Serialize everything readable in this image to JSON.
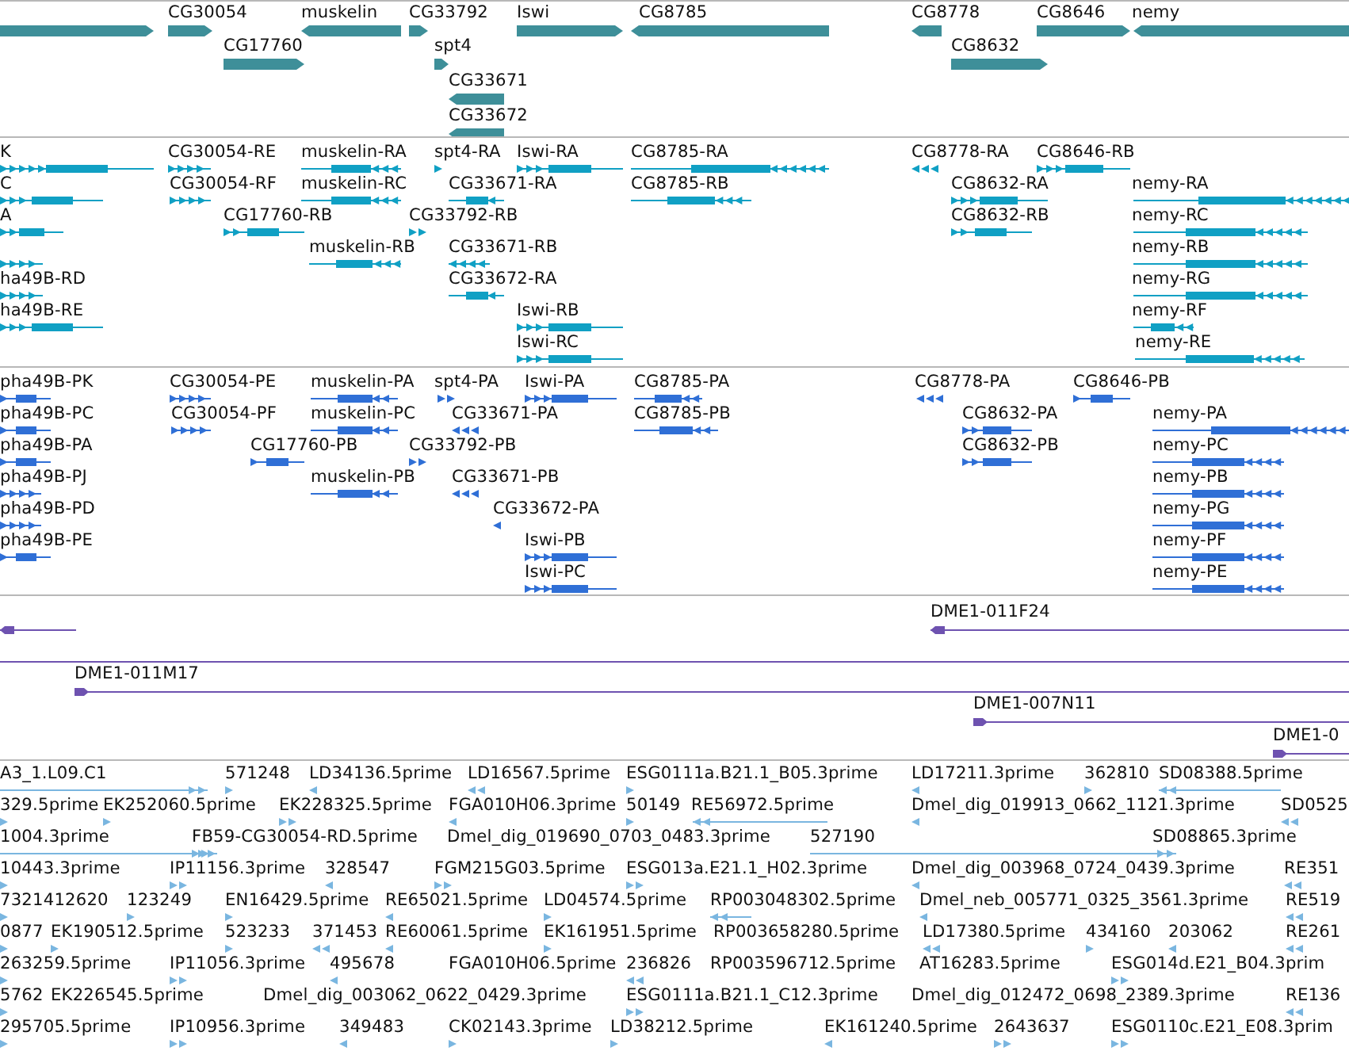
{
  "tracks": [
    {
      "kind": "gene",
      "rows": [
        {
          "features": [
            {
              "kind": "forward"
            },
            {
              "label": "CG30054",
              "kind": "forward"
            },
            {
              "label": "muskelin",
              "kind": "reverse"
            },
            {
              "label": "CG33792",
              "kind": "forward"
            },
            {
              "label": "Iswi",
              "kind": "forward"
            },
            {
              "label": "CG8785",
              "kind": "reverse"
            },
            {
              "label": "CG8778",
              "kind": "reverse"
            },
            {
              "label": "CG8646",
              "kind": "forward"
            },
            {
              "label": "nemy",
              "kind": "reverse"
            }
          ]
        },
        {
          "features": [
            {
              "label": "CG17760",
              "kind": "forward"
            },
            {
              "label": "spt4",
              "kind": "forward"
            },
            {
              "label": "CG8632",
              "kind": "forward"
            }
          ]
        },
        {
          "features": [
            {
              "label": "CG33671",
              "kind": "reverse"
            }
          ]
        },
        {
          "features": [
            {
              "label": "CG33672",
              "kind": "reverse"
            }
          ]
        }
      ]
    },
    {
      "kind": "transcript",
      "rows": [
        {
          "features": [
            {
              "label": "K",
              "kind": "forward"
            },
            {
              "label": "CG30054-RE",
              "kind": "forward"
            },
            {
              "label": "muskelin-RA",
              "kind": "reverse"
            },
            {
              "label": "spt4-RA",
              "kind": "forward"
            },
            {
              "label": "Iswi-RA",
              "kind": "forward"
            },
            {
              "label": "CG8785-RA",
              "kind": "reverse"
            },
            {
              "label": "CG8778-RA",
              "kind": "reverse"
            },
            {
              "label": "CG8646-RB",
              "kind": "forward"
            }
          ]
        },
        {
          "features": [
            {
              "label": "C",
              "kind": "forward"
            },
            {
              "label": "CG30054-RF",
              "kind": "forward"
            },
            {
              "label": "muskelin-RC",
              "kind": "reverse"
            },
            {
              "label": "CG33671-RA",
              "kind": "reverse"
            },
            {
              "label": "CG8785-RB",
              "kind": "reverse"
            },
            {
              "label": "CG8632-RA",
              "kind": "forward"
            },
            {
              "label": "nemy-RA",
              "kind": "reverse"
            }
          ]
        },
        {
          "features": [
            {
              "label": "A",
              "kind": "forward"
            },
            {
              "label": "CG17760-RB",
              "kind": "forward"
            },
            {
              "label": "CG33792-RB",
              "kind": "forward"
            },
            {
              "label": "CG8632-RB",
              "kind": "forward"
            },
            {
              "label": "nemy-RC",
              "kind": "reverse"
            }
          ]
        },
        {
          "features": [
            {
              "kind": "forward"
            },
            {
              "label": "muskelin-RB",
              "kind": "reverse"
            },
            {
              "label": "CG33671-RB",
              "kind": "reverse"
            },
            {
              "label": "nemy-RB",
              "kind": "reverse"
            }
          ]
        },
        {
          "features": [
            {
              "label": "ha49B-RD",
              "kind": "forward"
            },
            {
              "label": "CG33672-RA",
              "kind": "reverse"
            },
            {
              "label": "nemy-RG",
              "kind": "reverse"
            }
          ]
        },
        {
          "features": [
            {
              "label": "ha49B-RE",
              "kind": "forward"
            },
            {
              "label": "Iswi-RB",
              "kind": "forward"
            },
            {
              "label": "nemy-RF",
              "kind": "reverse"
            }
          ]
        },
        {
          "features": [
            {
              "label": "Iswi-RC",
              "kind": "forward"
            },
            {
              "label": "nemy-RE",
              "kind": "reverse"
            }
          ]
        }
      ]
    },
    {
      "kind": "protein",
      "rows": [
        {
          "features": [
            {
              "label": "pha49B-PK",
              "kind": "forward"
            },
            {
              "label": "CG30054-PE",
              "kind": "forward"
            },
            {
              "label": "muskelin-PA",
              "kind": "reverse"
            },
            {
              "label": "spt4-PA",
              "kind": "forward"
            },
            {
              "label": "Iswi-PA",
              "kind": "forward"
            },
            {
              "label": "CG8785-PA",
              "kind": "reverse"
            },
            {
              "label": "CG8778-PA",
              "kind": "reverse"
            },
            {
              "label": "CG8646-PB",
              "kind": "forward"
            }
          ]
        },
        {
          "features": [
            {
              "label": "pha49B-PC",
              "kind": "forward"
            },
            {
              "label": "CG30054-PF",
              "kind": "forward"
            },
            {
              "label": "muskelin-PC",
              "kind": "reverse"
            },
            {
              "label": "CG33671-PA",
              "kind": "reverse"
            },
            {
              "label": "CG8785-PB",
              "kind": "reverse"
            },
            {
              "label": "CG8632-PA",
              "kind": "forward"
            },
            {
              "label": "nemy-PA",
              "kind": "reverse"
            }
          ]
        },
        {
          "features": [
            {
              "label": "pha49B-PA",
              "kind": "forward"
            },
            {
              "label": "CG17760-PB",
              "kind": "forward"
            },
            {
              "label": "CG33792-PB",
              "kind": "forward"
            },
            {
              "label": "CG8632-PB",
              "kind": "forward"
            },
            {
              "label": "nemy-PC",
              "kind": "reverse"
            }
          ]
        },
        {
          "features": [
            {
              "label": "pha49B-PJ",
              "kind": "forward"
            },
            {
              "label": "muskelin-PB",
              "kind": "reverse"
            },
            {
              "label": "CG33671-PB",
              "kind": "reverse"
            },
            {
              "label": "nemy-PB",
              "kind": "reverse"
            }
          ]
        },
        {
          "features": [
            {
              "label": "pha49B-PD",
              "kind": "forward"
            },
            {
              "label": "CG33672-PA",
              "kind": "reverse"
            },
            {
              "label": "nemy-PG",
              "kind": "reverse"
            }
          ]
        },
        {
          "features": [
            {
              "label": "pha49B-PE",
              "kind": "forward"
            },
            {
              "label": "Iswi-PB",
              "kind": "forward"
            },
            {
              "label": "nemy-PF",
              "kind": "reverse"
            }
          ]
        },
        {
          "features": [
            {
              "label": "Iswi-PC",
              "kind": "forward"
            },
            {
              "label": "nemy-PE",
              "kind": "reverse"
            }
          ]
        }
      ]
    },
    {
      "kind": "clone",
      "rows": [
        {
          "features": [
            {
              "kind": "reverse"
            },
            {
              "label": "DME1-011F24",
              "kind": "reverse"
            }
          ]
        },
        {
          "features": [
            {
              "kind": "line"
            }
          ]
        },
        {
          "features": [
            {
              "label": "DME1-011M17",
              "kind": "forward"
            }
          ]
        },
        {
          "features": [
            {
              "label": "DME1-007N11",
              "kind": "forward"
            }
          ]
        },
        {
          "features": [
            {
              "label": "DME1-0",
              "kind": "forward"
            }
          ]
        }
      ]
    },
    {
      "kind": "est",
      "rows": [
        {
          "features": [
            {
              "label": "A3_1.L09.C1",
              "kind": "forward"
            },
            {
              "label": "571248",
              "kind": "forward"
            },
            {
              "label": "LD34136.5prime",
              "kind": "reverse"
            },
            {
              "label": "LD16567.5prime",
              "kind": "reverse"
            },
            {
              "label": "ESG0111a.B21.1_B05.3prime",
              "kind": "forward"
            },
            {
              "label": "LD17211.3prime",
              "kind": "reverse"
            },
            {
              "label": "362810",
              "kind": "forward"
            },
            {
              "label": "SD08388.5prime",
              "kind": "reverse"
            }
          ]
        },
        {
          "features": [
            {
              "label": "329.5prime",
              "kind": "forward"
            },
            {
              "label": "EK252060.5prime",
              "kind": "forward"
            },
            {
              "label": "EK228325.5prime",
              "kind": "forward"
            },
            {
              "label": "FGA010H06.3prime",
              "kind": "reverse"
            },
            {
              "label": "50149",
              "kind": "forward"
            },
            {
              "label": "RE56972.5prime",
              "kind": "reverse"
            },
            {
              "label": "Dmel_dig_019913_0662_1121.3prime",
              "kind": "reverse"
            },
            {
              "label": "SD0525",
              "kind": "reverse"
            }
          ]
        },
        {
          "features": [
            {
              "label": "1004.3prime",
              "kind": "forward"
            },
            {
              "label": "FB59-CG30054-RD.5prime",
              "kind": "forward"
            },
            {
              "label": "Dmel_dig_019690_0703_0483.3prime"
            },
            {
              "label": "527190",
              "kind": "forward"
            },
            {
              "label": "SD08865.3prime"
            }
          ]
        },
        {
          "features": [
            {
              "label": "10443.3prime",
              "kind": "forward"
            },
            {
              "label": "IP11156.3prime",
              "kind": "forward"
            },
            {
              "label": "328547",
              "kind": "reverse"
            },
            {
              "label": "FGM215G03.5prime",
              "kind": "forward"
            },
            {
              "label": "ESG013a.E21.1_H02.3prime",
              "kind": "forward"
            },
            {
              "label": "Dmel_dig_003968_0724_0439.3prime",
              "kind": "reverse"
            },
            {
              "label": "RE351",
              "kind": "reverse"
            }
          ]
        },
        {
          "features": [
            {
              "label": "7321412620",
              "kind": "forward"
            },
            {
              "label": "123249",
              "kind": "forward"
            },
            {
              "label": "EN16429.5prime",
              "kind": "forward"
            },
            {
              "label": "RE65021.5prime",
              "kind": "reverse"
            },
            {
              "label": "LD04574.5prime",
              "kind": "forward"
            },
            {
              "label": "RP003048302.5prime",
              "kind": "reverse"
            },
            {
              "label": "Dmel_neb_005771_0325_3561.3prime",
              "kind": "reverse"
            },
            {
              "label": "RE519",
              "kind": "reverse"
            }
          ]
        },
        {
          "features": [
            {
              "label": "0877",
              "kind": "forward"
            },
            {
              "label": "EK190512.5prime",
              "kind": "forward"
            },
            {
              "label": "523233",
              "kind": "forward"
            },
            {
              "label": "371453",
              "kind": "reverse"
            },
            {
              "label": "RE60061.5prime",
              "kind": "reverse"
            },
            {
              "label": "EK161951.5prime",
              "kind": "forward"
            },
            {
              "label": "RP003658280.5prime"
            },
            {
              "label": "LD17380.5prime",
              "kind": "reverse"
            },
            {
              "label": "434160",
              "kind": "forward"
            },
            {
              "label": "203062",
              "kind": "reverse"
            },
            {
              "label": "RE261",
              "kind": "reverse"
            }
          ]
        },
        {
          "features": [
            {
              "label": "263259.5prime",
              "kind": "forward"
            },
            {
              "label": "IP11056.3prime",
              "kind": "forward"
            },
            {
              "label": "495678",
              "kind": "reverse"
            },
            {
              "label": "FGA010H06.5prime"
            },
            {
              "label": "236826",
              "kind": "reverse"
            },
            {
              "label": "RP003596712.5prime"
            },
            {
              "label": "AT16283.5prime"
            },
            {
              "label": "ESG014d.E21_B04.3prim",
              "kind": "forward"
            }
          ]
        },
        {
          "features": [
            {
              "label": "5762",
              "kind": "forward"
            },
            {
              "label": "EK226545.5prime"
            },
            {
              "label": "Dmel_dig_003062_0622_0429.3prime"
            },
            {
              "label": "ESG0111a.B21.1_C12.3prime",
              "kind": "forward"
            },
            {
              "label": "Dmel_dig_012472_0698_2389.3prime"
            },
            {
              "label": "RE136",
              "kind": "reverse"
            }
          ]
        },
        {
          "features": [
            {
              "label": "295705.5prime",
              "kind": "forward"
            },
            {
              "label": "IP10956.3prime",
              "kind": "forward"
            },
            {
              "label": "349483",
              "kind": "reverse"
            },
            {
              "label": "CK02143.3prime",
              "kind": "forward"
            },
            {
              "label": "LD38212.5prime",
              "kind": "forward"
            },
            {
              "label": "EK161240.5prime",
              "kind": "reverse"
            },
            {
              "label": "2643637",
              "kind": "forward"
            },
            {
              "label": "ESG0110c.E21_E08.3prim",
              "kind": "forward"
            }
          ]
        }
      ]
    }
  ]
}
